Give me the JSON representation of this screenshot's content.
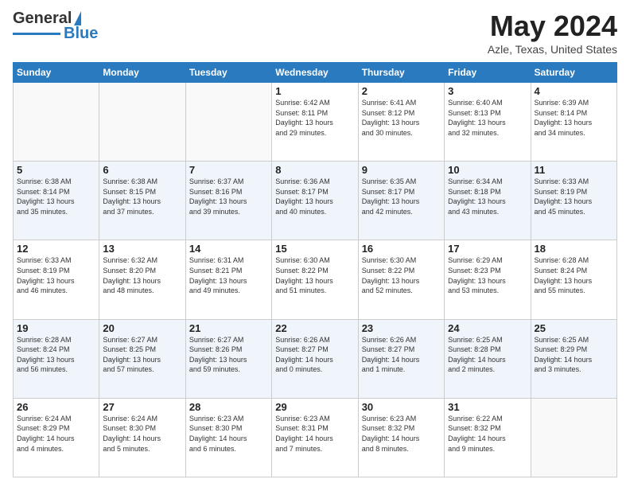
{
  "header": {
    "logo_general": "General",
    "logo_blue": "Blue",
    "title": "May 2024",
    "location": "Azle, Texas, United States"
  },
  "days_of_week": [
    "Sunday",
    "Monday",
    "Tuesday",
    "Wednesday",
    "Thursday",
    "Friday",
    "Saturday"
  ],
  "weeks": [
    [
      {
        "num": "",
        "info": ""
      },
      {
        "num": "",
        "info": ""
      },
      {
        "num": "",
        "info": ""
      },
      {
        "num": "1",
        "info": "Sunrise: 6:42 AM\nSunset: 8:11 PM\nDaylight: 13 hours\nand 29 minutes."
      },
      {
        "num": "2",
        "info": "Sunrise: 6:41 AM\nSunset: 8:12 PM\nDaylight: 13 hours\nand 30 minutes."
      },
      {
        "num": "3",
        "info": "Sunrise: 6:40 AM\nSunset: 8:13 PM\nDaylight: 13 hours\nand 32 minutes."
      },
      {
        "num": "4",
        "info": "Sunrise: 6:39 AM\nSunset: 8:14 PM\nDaylight: 13 hours\nand 34 minutes."
      }
    ],
    [
      {
        "num": "5",
        "info": "Sunrise: 6:38 AM\nSunset: 8:14 PM\nDaylight: 13 hours\nand 35 minutes."
      },
      {
        "num": "6",
        "info": "Sunrise: 6:38 AM\nSunset: 8:15 PM\nDaylight: 13 hours\nand 37 minutes."
      },
      {
        "num": "7",
        "info": "Sunrise: 6:37 AM\nSunset: 8:16 PM\nDaylight: 13 hours\nand 39 minutes."
      },
      {
        "num": "8",
        "info": "Sunrise: 6:36 AM\nSunset: 8:17 PM\nDaylight: 13 hours\nand 40 minutes."
      },
      {
        "num": "9",
        "info": "Sunrise: 6:35 AM\nSunset: 8:17 PM\nDaylight: 13 hours\nand 42 minutes."
      },
      {
        "num": "10",
        "info": "Sunrise: 6:34 AM\nSunset: 8:18 PM\nDaylight: 13 hours\nand 43 minutes."
      },
      {
        "num": "11",
        "info": "Sunrise: 6:33 AM\nSunset: 8:19 PM\nDaylight: 13 hours\nand 45 minutes."
      }
    ],
    [
      {
        "num": "12",
        "info": "Sunrise: 6:33 AM\nSunset: 8:19 PM\nDaylight: 13 hours\nand 46 minutes."
      },
      {
        "num": "13",
        "info": "Sunrise: 6:32 AM\nSunset: 8:20 PM\nDaylight: 13 hours\nand 48 minutes."
      },
      {
        "num": "14",
        "info": "Sunrise: 6:31 AM\nSunset: 8:21 PM\nDaylight: 13 hours\nand 49 minutes."
      },
      {
        "num": "15",
        "info": "Sunrise: 6:30 AM\nSunset: 8:22 PM\nDaylight: 13 hours\nand 51 minutes."
      },
      {
        "num": "16",
        "info": "Sunrise: 6:30 AM\nSunset: 8:22 PM\nDaylight: 13 hours\nand 52 minutes."
      },
      {
        "num": "17",
        "info": "Sunrise: 6:29 AM\nSunset: 8:23 PM\nDaylight: 13 hours\nand 53 minutes."
      },
      {
        "num": "18",
        "info": "Sunrise: 6:28 AM\nSunset: 8:24 PM\nDaylight: 13 hours\nand 55 minutes."
      }
    ],
    [
      {
        "num": "19",
        "info": "Sunrise: 6:28 AM\nSunset: 8:24 PM\nDaylight: 13 hours\nand 56 minutes."
      },
      {
        "num": "20",
        "info": "Sunrise: 6:27 AM\nSunset: 8:25 PM\nDaylight: 13 hours\nand 57 minutes."
      },
      {
        "num": "21",
        "info": "Sunrise: 6:27 AM\nSunset: 8:26 PM\nDaylight: 13 hours\nand 59 minutes."
      },
      {
        "num": "22",
        "info": "Sunrise: 6:26 AM\nSunset: 8:27 PM\nDaylight: 14 hours\nand 0 minutes."
      },
      {
        "num": "23",
        "info": "Sunrise: 6:26 AM\nSunset: 8:27 PM\nDaylight: 14 hours\nand 1 minute."
      },
      {
        "num": "24",
        "info": "Sunrise: 6:25 AM\nSunset: 8:28 PM\nDaylight: 14 hours\nand 2 minutes."
      },
      {
        "num": "25",
        "info": "Sunrise: 6:25 AM\nSunset: 8:29 PM\nDaylight: 14 hours\nand 3 minutes."
      }
    ],
    [
      {
        "num": "26",
        "info": "Sunrise: 6:24 AM\nSunset: 8:29 PM\nDaylight: 14 hours\nand 4 minutes."
      },
      {
        "num": "27",
        "info": "Sunrise: 6:24 AM\nSunset: 8:30 PM\nDaylight: 14 hours\nand 5 minutes."
      },
      {
        "num": "28",
        "info": "Sunrise: 6:23 AM\nSunset: 8:30 PM\nDaylight: 14 hours\nand 6 minutes."
      },
      {
        "num": "29",
        "info": "Sunrise: 6:23 AM\nSunset: 8:31 PM\nDaylight: 14 hours\nand 7 minutes."
      },
      {
        "num": "30",
        "info": "Sunrise: 6:23 AM\nSunset: 8:32 PM\nDaylight: 14 hours\nand 8 minutes."
      },
      {
        "num": "31",
        "info": "Sunrise: 6:22 AM\nSunset: 8:32 PM\nDaylight: 14 hours\nand 9 minutes."
      },
      {
        "num": "",
        "info": ""
      }
    ]
  ]
}
